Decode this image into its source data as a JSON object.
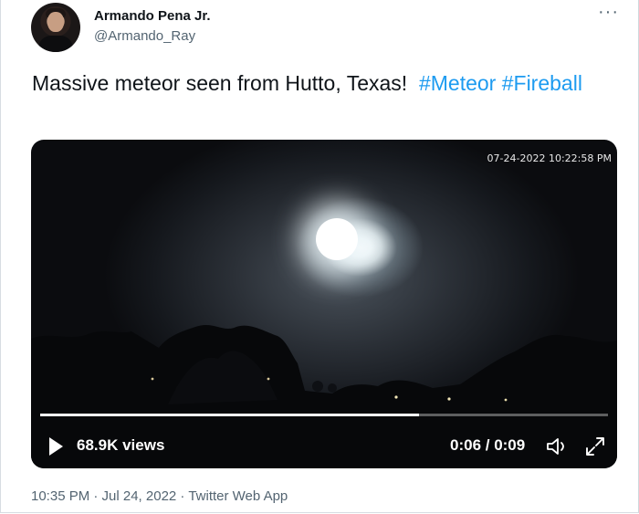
{
  "author": {
    "name": "Armando Pena Jr.",
    "handle": "@Armando_Ray"
  },
  "menu": {
    "more_icon": "more-horizontal-icon",
    "more_label": "···"
  },
  "tweet": {
    "text": "Massive meteor seen from Hutto, Texas!",
    "hashtags": [
      "#Meteor",
      "#Fireball"
    ]
  },
  "video": {
    "timestamp_overlay": "07-24-2022 10:22:58 PM",
    "views": "68.9K views",
    "time": "0:06 / 0:09",
    "progress": 0.6667,
    "icons": {
      "play": "play-icon",
      "volume": "volume-icon",
      "fullscreen": "fullscreen-icon"
    }
  },
  "footer": {
    "meta": "10:35 PM · Jul 24, 2022 · Twitter Web App"
  },
  "colors": {
    "accent": "#1d9bf0",
    "secondary_text": "#536471"
  }
}
